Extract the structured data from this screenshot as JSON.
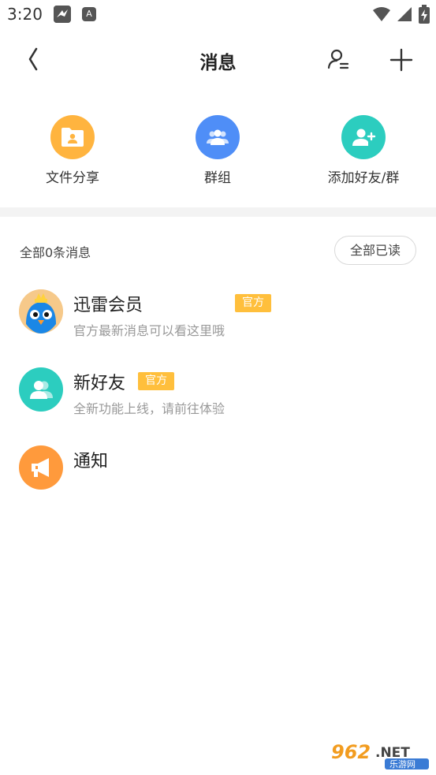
{
  "status_bar": {
    "time": "3:20",
    "app_icons": [
      "bird-icon",
      "a-icon"
    ],
    "right_icons": [
      "wifi-icon",
      "signal-icon",
      "battery-icon"
    ]
  },
  "header": {
    "title": "消息",
    "back_icon": "chevron-left-icon",
    "contacts_icon": "user-list-icon",
    "add_icon": "plus-icon"
  },
  "shortcuts": [
    {
      "label": "文件分享",
      "icon": "folder-user-icon",
      "color": "#ffb43f"
    },
    {
      "label": "群组",
      "icon": "group-icon",
      "color": "#4f8ef7"
    },
    {
      "label": "添加好友/群",
      "icon": "add-user-icon",
      "color": "#2ccdbf"
    }
  ],
  "list_header": {
    "count_text": "全部0条消息",
    "mark_all_read": "全部已读"
  },
  "messages": [
    {
      "title": "迅雷会员",
      "badge": "官方",
      "subtitle": "官方最新消息可以看这里哦",
      "avatar": "bird-mascot-avatar",
      "avatar_color": "#1b87e6"
    },
    {
      "title": "新好友",
      "badge": "官方",
      "subtitle": "全新功能上线，请前往体验",
      "avatar": "new-friend-icon",
      "avatar_color": "#2ccdbf"
    },
    {
      "title": "通知",
      "badge": "",
      "subtitle": "",
      "avatar": "megaphone-icon",
      "avatar_color": "#ff9a3c"
    }
  ],
  "watermark": {
    "text_main": "962.NET",
    "text_sub": "乐游网"
  },
  "colors": {
    "badge": "#ffbf3c",
    "divider": "#f3f3f3"
  }
}
